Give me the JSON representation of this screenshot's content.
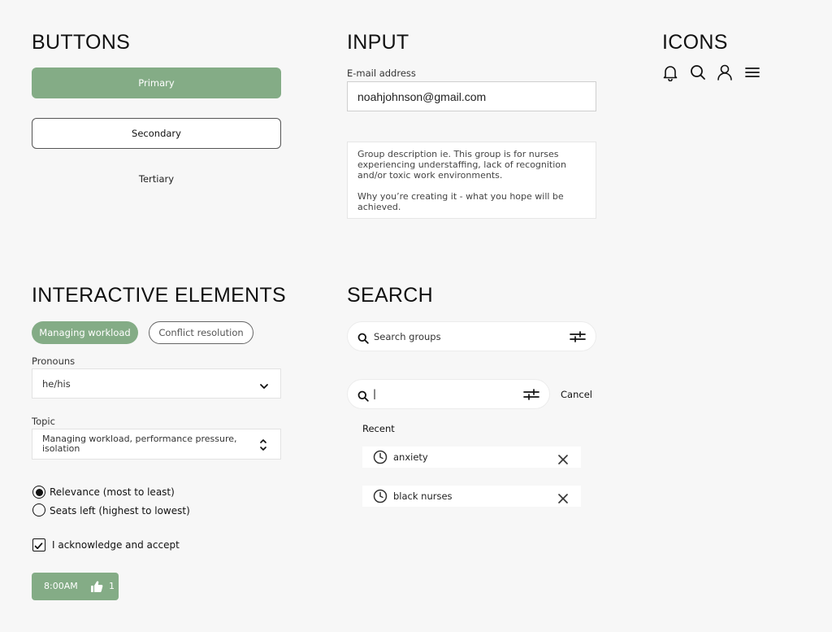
{
  "sections": {
    "buttons": "BUTTONS",
    "input": "INPUT",
    "icons": "ICONS",
    "interactive": "INTERACTIVE ELEMENTS",
    "search": "SEARCH"
  },
  "buttons": {
    "primary": "Primary",
    "secondary": "Secondary",
    "tertiary": "Tertiary"
  },
  "input": {
    "email_label": "E-mail address",
    "email_value": "noahjohnson@gmail.com",
    "description_line1": "Group description ie. This group is for nurses experiencing understaffing, lack of recognition and/or toxic work environments.",
    "description_line2": "Why you’re creating it - what you hope will be achieved."
  },
  "icons": [
    "bell-icon",
    "search-icon",
    "user-icon",
    "menu-icon"
  ],
  "interactive": {
    "chips": [
      "Managing workload",
      "Conflict resolution"
    ],
    "pronouns_label": "Pronouns",
    "pronouns_value": "he/his",
    "topic_label": "Topic",
    "topic_value": "Managing workload, performance pressure, isolation",
    "radio_options": [
      "Relevance (most to least)",
      "Seats left (highest to lowest)"
    ],
    "radio_selected": 0,
    "checkbox_label": "I acknowledge and accept",
    "checkbox_checked": true,
    "time_pill": {
      "time": "8:00AM",
      "likes": "1"
    }
  },
  "search": {
    "placeholder": "Search groups",
    "active_value": "|",
    "cancel": "Cancel",
    "recent_label": "Recent",
    "recent_items": [
      "anxiety",
      "black nurses"
    ]
  },
  "colors": {
    "accent": "#84ac86",
    "background": "#f7f7f7"
  }
}
